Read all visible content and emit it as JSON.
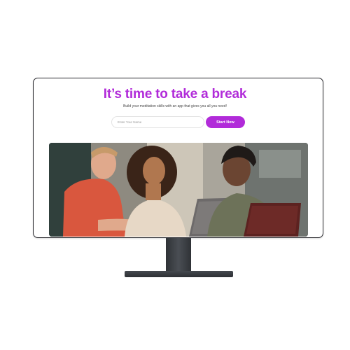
{
  "hero": {
    "title": "It’s time to take a break",
    "subtitle": "Build your meditation skills with an app that gives you all you need!"
  },
  "signup": {
    "name_placeholder": "Enter Your Name",
    "name_value": "",
    "button_label": "Start Now"
  },
  "colors": {
    "accent": "#b12bd9",
    "bezel": "#2b2b30",
    "stand": "#3a3d42"
  },
  "photo": {
    "subject": "three-people-with-laptops-photo"
  }
}
